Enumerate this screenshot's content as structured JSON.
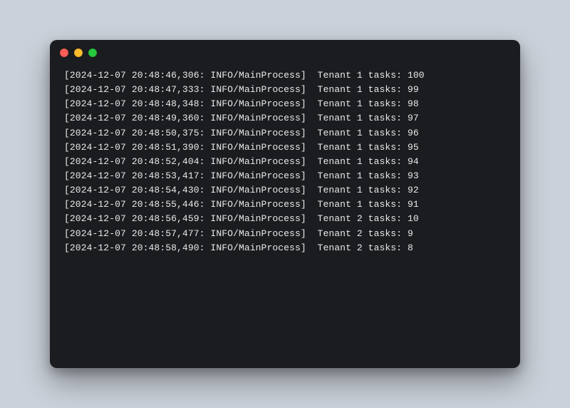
{
  "terminal": {
    "traffic_lights": [
      "close",
      "minimize",
      "zoom"
    ],
    "log": {
      "level": "INFO",
      "process": "MainProcess",
      "date": "2024-12-07",
      "lines": [
        {
          "timestamp": "2024-12-07 20:48:46,306",
          "prefix": "[2024-12-07 20:48:46,306: INFO/MainProcess]",
          "tenant": 1,
          "tasks": 100,
          "message": "Tenant 1 tasks: 100"
        },
        {
          "timestamp": "2024-12-07 20:48:47,333",
          "prefix": "[2024-12-07 20:48:47,333: INFO/MainProcess]",
          "tenant": 1,
          "tasks": 99,
          "message": "Tenant 1 tasks: 99"
        },
        {
          "timestamp": "2024-12-07 20:48:48,348",
          "prefix": "[2024-12-07 20:48:48,348: INFO/MainProcess]",
          "tenant": 1,
          "tasks": 98,
          "message": "Tenant 1 tasks: 98"
        },
        {
          "timestamp": "2024-12-07 20:48:49,360",
          "prefix": "[2024-12-07 20:48:49,360: INFO/MainProcess]",
          "tenant": 1,
          "tasks": 97,
          "message": "Tenant 1 tasks: 97"
        },
        {
          "timestamp": "2024-12-07 20:48:50,375",
          "prefix": "[2024-12-07 20:48:50,375: INFO/MainProcess]",
          "tenant": 1,
          "tasks": 96,
          "message": "Tenant 1 tasks: 96"
        },
        {
          "timestamp": "2024-12-07 20:48:51,390",
          "prefix": "[2024-12-07 20:48:51,390: INFO/MainProcess]",
          "tenant": 1,
          "tasks": 95,
          "message": "Tenant 1 tasks: 95"
        },
        {
          "timestamp": "2024-12-07 20:48:52,404",
          "prefix": "[2024-12-07 20:48:52,404: INFO/MainProcess]",
          "tenant": 1,
          "tasks": 94,
          "message": "Tenant 1 tasks: 94"
        },
        {
          "timestamp": "2024-12-07 20:48:53,417",
          "prefix": "[2024-12-07 20:48:53,417: INFO/MainProcess]",
          "tenant": 1,
          "tasks": 93,
          "message": "Tenant 1 tasks: 93"
        },
        {
          "timestamp": "2024-12-07 20:48:54,430",
          "prefix": "[2024-12-07 20:48:54,430: INFO/MainProcess]",
          "tenant": 1,
          "tasks": 92,
          "message": "Tenant 1 tasks: 92"
        },
        {
          "timestamp": "2024-12-07 20:48:55,446",
          "prefix": "[2024-12-07 20:48:55,446: INFO/MainProcess]",
          "tenant": 1,
          "tasks": 91,
          "message": "Tenant 1 tasks: 91"
        },
        {
          "timestamp": "2024-12-07 20:48:56,459",
          "prefix": "[2024-12-07 20:48:56,459: INFO/MainProcess]",
          "tenant": 2,
          "tasks": 10,
          "message": "Tenant 2 tasks: 10"
        },
        {
          "timestamp": "2024-12-07 20:48:57,477",
          "prefix": "[2024-12-07 20:48:57,477: INFO/MainProcess]",
          "tenant": 2,
          "tasks": 9,
          "message": "Tenant 2 tasks: 9"
        },
        {
          "timestamp": "2024-12-07 20:48:58,490",
          "prefix": "[2024-12-07 20:48:58,490: INFO/MainProcess]",
          "tenant": 2,
          "tasks": 8,
          "message": "Tenant 2 tasks: 8"
        }
      ]
    }
  }
}
